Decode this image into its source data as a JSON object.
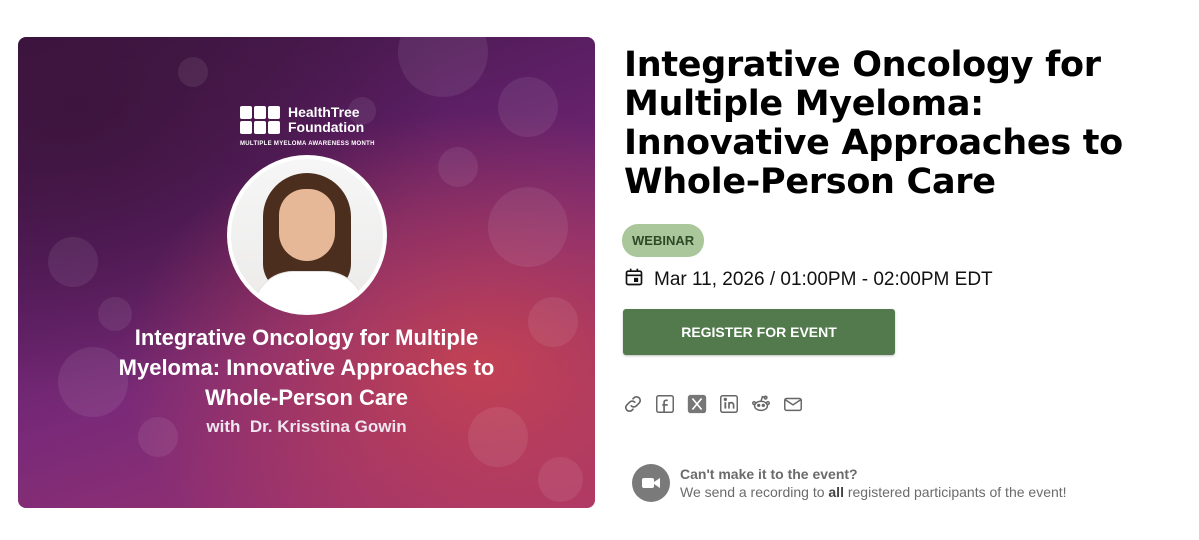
{
  "banner": {
    "logo_line1": "HealthTree",
    "logo_line2": "Foundation",
    "logo_sub": "MULTIPLE MYELOMA AWARENESS MONTH",
    "title_line1": "Integrative Oncology for Multiple",
    "title_line2": "Myeloma: Innovative Approaches to",
    "title_line3": "Whole-Person Care",
    "speaker": "with  Dr. Krisstina Gowin"
  },
  "event": {
    "title": "Integrative Oncology for Multiple Myeloma: Innovative Approaches to Whole-Person Care",
    "badge": "WEBINAR",
    "datetime": "Mar 11, 2026 / 01:00PM - 02:00PM EDT",
    "register_label": "REGISTER FOR EVENT"
  },
  "share_icons": [
    "link-icon",
    "facebook-icon",
    "x-icon",
    "linkedin-icon",
    "reddit-icon",
    "email-icon"
  ],
  "recording": {
    "title": "Can't make it to the event?",
    "desc_before": "We send a recording to ",
    "desc_bold": "all",
    "desc_after": " registered participants of the event!"
  },
  "colors": {
    "accent_green": "#527a4d",
    "badge_bg": "#a9c79a",
    "badge_text": "#2d4a28"
  }
}
